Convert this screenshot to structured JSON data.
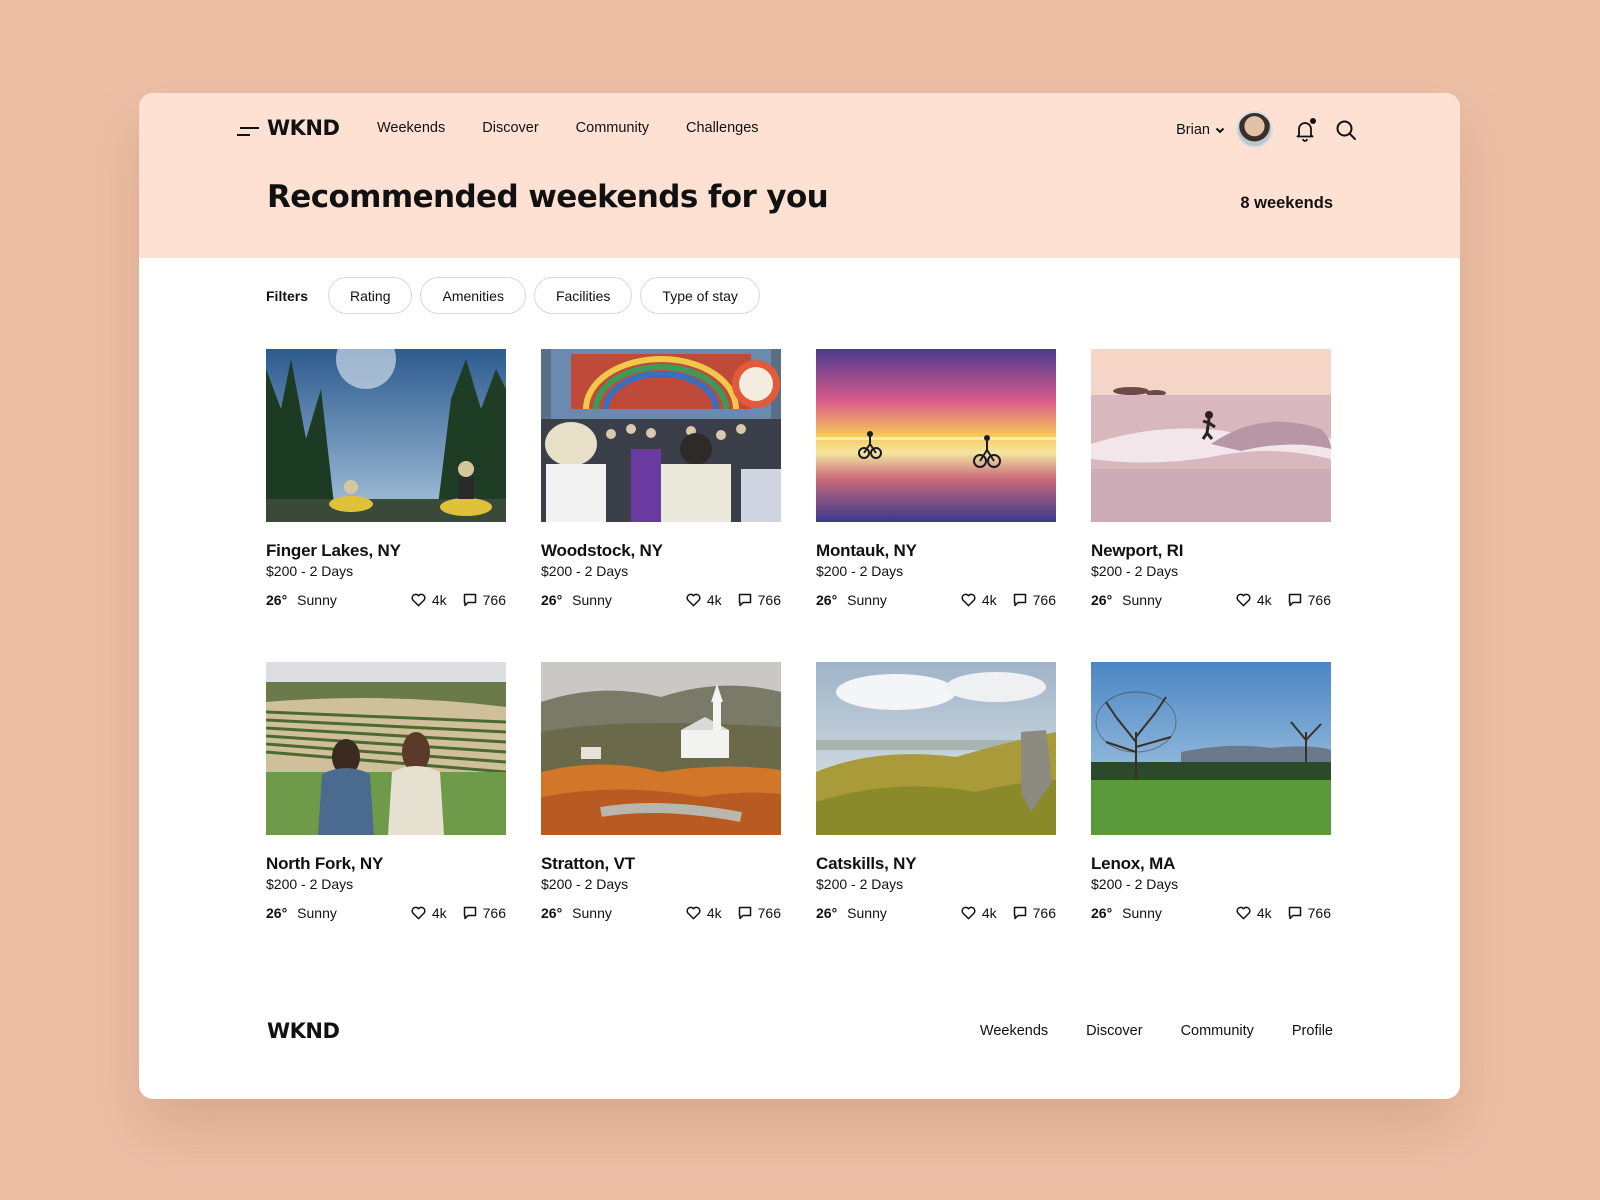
{
  "app": {
    "logo": "WKND",
    "colors": {
      "background": "#EDC0A6",
      "hero": "#FFE1D3",
      "text": "#111111",
      "chip_border": "#D8D8D8"
    }
  },
  "nav": {
    "links": [
      "Weekends",
      "Discover",
      "Community",
      "Challenges"
    ],
    "user_name": "Brian",
    "icons": [
      "menu-icon",
      "chevron-down-icon",
      "avatar",
      "bell-icon",
      "search-icon"
    ]
  },
  "hero": {
    "title": "Recommended weekends for you",
    "count": "8 weekends"
  },
  "filters": {
    "label": "Filters",
    "chips": [
      "Rating",
      "Amenities",
      "Facilities",
      "Type of stay"
    ]
  },
  "cards": [
    {
      "title": "Finger Lakes, NY",
      "price": "$200 - 2 Days",
      "temp": "26°",
      "weather": "Sunny",
      "likes": "4k",
      "comments": "766",
      "photo": "kayaking"
    },
    {
      "title": "Woodstock, NY",
      "price": "$200 - 2 Days",
      "temp": "26°",
      "weather": "Sunny",
      "likes": "4k",
      "comments": "766",
      "photo": "festival"
    },
    {
      "title": "Montauk, NY",
      "price": "$200 - 2 Days",
      "temp": "26°",
      "weather": "Sunny",
      "likes": "4k",
      "comments": "766",
      "photo": "sunset-beach"
    },
    {
      "title": "Newport, RI",
      "price": "$200 - 2 Days",
      "temp": "26°",
      "weather": "Sunny",
      "likes": "4k",
      "comments": "766",
      "photo": "surfer"
    },
    {
      "title": "North Fork, NY",
      "price": "$200 - 2 Days",
      "temp": "26°",
      "weather": "Sunny",
      "likes": "4k",
      "comments": "766",
      "photo": "vineyard"
    },
    {
      "title": "Stratton, VT",
      "price": "$200 - 2 Days",
      "temp": "26°",
      "weather": "Sunny",
      "likes": "4k",
      "comments": "766",
      "photo": "autumn-church"
    },
    {
      "title": "Catskills, NY",
      "price": "$200 - 2 Days",
      "temp": "26°",
      "weather": "Sunny",
      "likes": "4k",
      "comments": "766",
      "photo": "valley"
    },
    {
      "title": "Lenox, MA",
      "price": "$200 - 2 Days",
      "temp": "26°",
      "weather": "Sunny",
      "likes": "4k",
      "comments": "766",
      "photo": "meadow"
    }
  ],
  "footer": {
    "logo": "WKND",
    "links": [
      "Weekends",
      "Discover",
      "Community",
      "Profile"
    ]
  }
}
